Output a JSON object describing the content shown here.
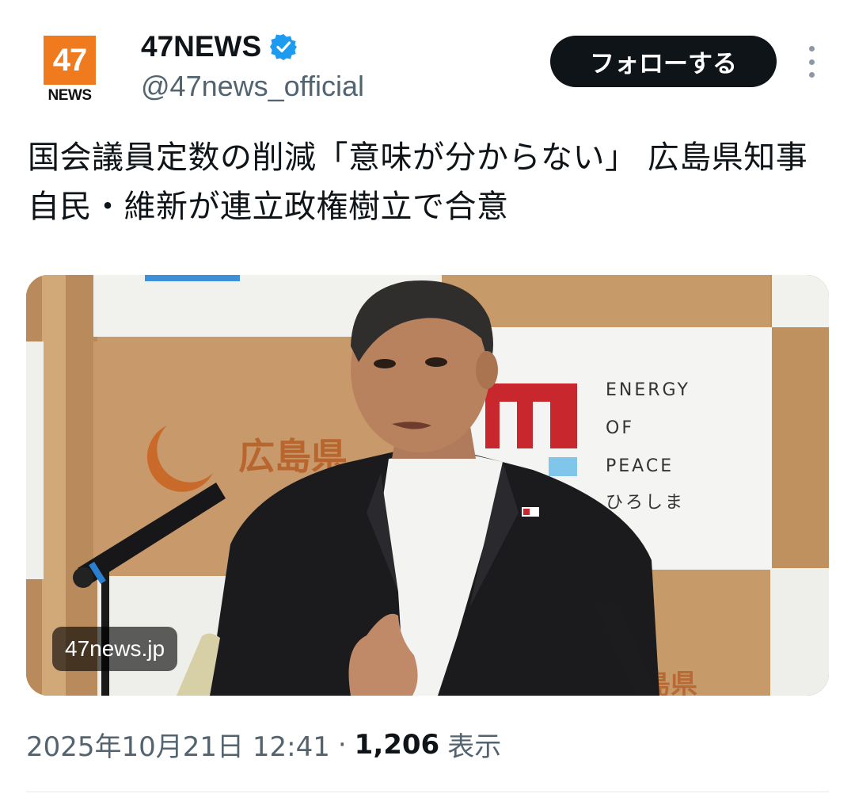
{
  "account": {
    "avatar_text": "47",
    "avatar_subtext": "NEWS",
    "display_name": "47NEWS",
    "handle": "@47news_official",
    "verified": true,
    "verified_icon": "verified-badge-icon",
    "accent_color": "#1d9bf0",
    "brand_color": "#f07a1e"
  },
  "actions": {
    "follow_label": "フォローする",
    "more_icon": "more-vertical-icon"
  },
  "tweet": {
    "text": "国会議員定数の削減「意味が分からない」 広島県知事　自民・維新が連立政権樹立で合意"
  },
  "media": {
    "type": "photo",
    "source_label": "47news.jp",
    "backdrop": {
      "logo_text": "広島県",
      "panel_lines": [
        "ENERGY",
        "OF",
        "PEACE",
        "ひろしま"
      ],
      "bottom_text": "島県"
    }
  },
  "meta": {
    "timestamp": "2025年10月21日 12:41",
    "separator": "·",
    "views_count": "1,206",
    "views_label": "表示"
  }
}
